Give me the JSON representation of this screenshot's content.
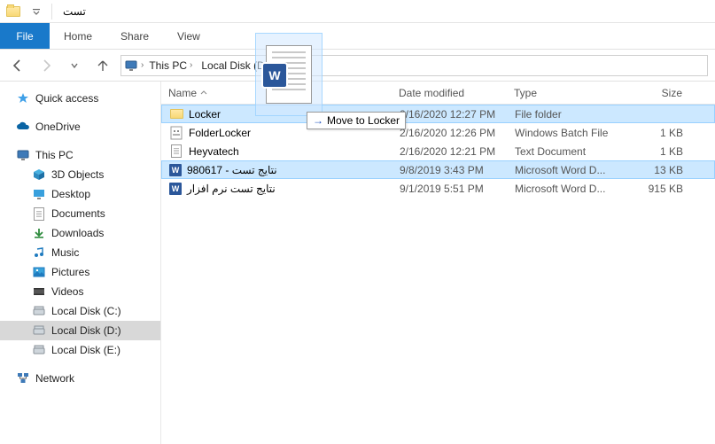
{
  "window": {
    "title": "تست"
  },
  "ribbon": {
    "file": "File",
    "tabs": [
      "Home",
      "Share",
      "View"
    ]
  },
  "breadcrumb": {
    "items": [
      "This PC",
      "Local Disk (D:)"
    ]
  },
  "nav": {
    "quick_access": "Quick access",
    "onedrive": "OneDrive",
    "this_pc": "This PC",
    "children": [
      {
        "label": "3D Objects",
        "icon": "cube"
      },
      {
        "label": "Desktop",
        "icon": "desktop"
      },
      {
        "label": "Documents",
        "icon": "doc"
      },
      {
        "label": "Downloads",
        "icon": "download"
      },
      {
        "label": "Music",
        "icon": "music"
      },
      {
        "label": "Pictures",
        "icon": "pictures"
      },
      {
        "label": "Videos",
        "icon": "videos"
      },
      {
        "label": "Local Disk (C:)",
        "icon": "disk"
      },
      {
        "label": "Local Disk (D:)",
        "icon": "disk",
        "selected": true
      },
      {
        "label": "Local Disk (E:)",
        "icon": "disk"
      }
    ],
    "network": "Network"
  },
  "columns": {
    "name": "Name",
    "date": "Date modified",
    "type": "Type",
    "size": "Size"
  },
  "rows": [
    {
      "name": "Locker",
      "date": "2/16/2020 12:27 PM",
      "type": "File folder",
      "size": "",
      "icon": "folder",
      "selected": true
    },
    {
      "name": "FolderLocker",
      "date": "2/16/2020 12:26 PM",
      "type": "Windows Batch File",
      "size": "1 KB",
      "icon": "batch"
    },
    {
      "name": "Heyvatech",
      "date": "2/16/2020 12:21 PM",
      "type": "Text Document",
      "size": "1 KB",
      "icon": "text"
    },
    {
      "name": "980617 - نتایج تست",
      "date": "9/8/2019 3:43 PM",
      "type": "Microsoft Word D...",
      "size": "13 KB",
      "icon": "word",
      "selected": true
    },
    {
      "name": "نتایج تست نرم افزار",
      "date": "9/1/2019 5:51 PM",
      "type": "Microsoft Word D...",
      "size": "915 KB",
      "icon": "word"
    }
  ],
  "drag": {
    "tooltip_prefix": "Move to ",
    "tooltip_target": "Locker"
  }
}
